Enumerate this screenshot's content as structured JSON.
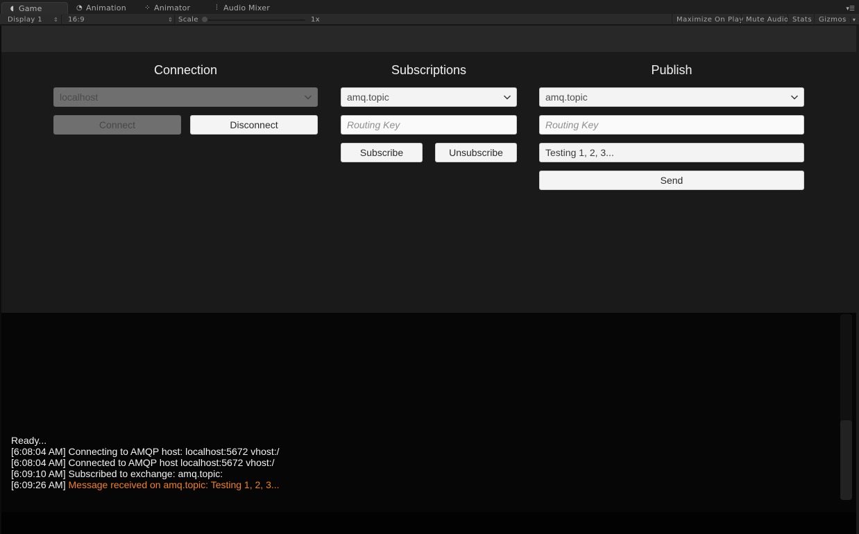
{
  "tabs": [
    {
      "label": "Game",
      "icon": "pacman-icon",
      "active": true
    },
    {
      "label": "Animation",
      "icon": "clock-icon",
      "active": false
    },
    {
      "label": "Animator",
      "icon": "animator-icon",
      "active": false
    },
    {
      "label": "Audio Mixer",
      "icon": "mixer-icon",
      "active": false
    }
  ],
  "toolbar": {
    "display": "Display 1",
    "aspect": "16:9",
    "scale_label": "Scale",
    "scale_value": "1x",
    "scale_fraction": 0.0,
    "maximize_on_play": "Maximize On Play",
    "mute_audio": "Mute Audio",
    "stats": "Stats",
    "gizmos": "Gizmos"
  },
  "connection": {
    "title": "Connection",
    "host": "localhost",
    "connect_label": "Connect",
    "disconnect_label": "Disconnect"
  },
  "subscriptions": {
    "title": "Subscriptions",
    "exchange": "amq.topic",
    "routing_key_placeholder": "Routing Key",
    "subscribe_label": "Subscribe",
    "unsubscribe_label": "Unsubscribe"
  },
  "publish": {
    "title": "Publish",
    "exchange": "amq.topic",
    "routing_key_placeholder": "Routing Key",
    "message": "Testing 1, 2, 3...",
    "send_label": "Send"
  },
  "log": {
    "lines": [
      {
        "prefix": "",
        "text": "Ready..."
      },
      {
        "prefix": "[6:08:04 AM] ",
        "text": "Connecting to AMQP host: localhost:5672 vhost:/"
      },
      {
        "prefix": "[6:08:04 AM] ",
        "text": "Connected to AMQP host localhost:5672 vhost:/"
      },
      {
        "prefix": "[6:09:10 AM] ",
        "text": "Subscribed to exchange: amq.topic:"
      },
      {
        "prefix": "[6:09:26 AM] ",
        "highlight": "Message received on amq.topic: Testing 1, 2, 3..."
      }
    ],
    "highlight_color": "#f0821e"
  }
}
